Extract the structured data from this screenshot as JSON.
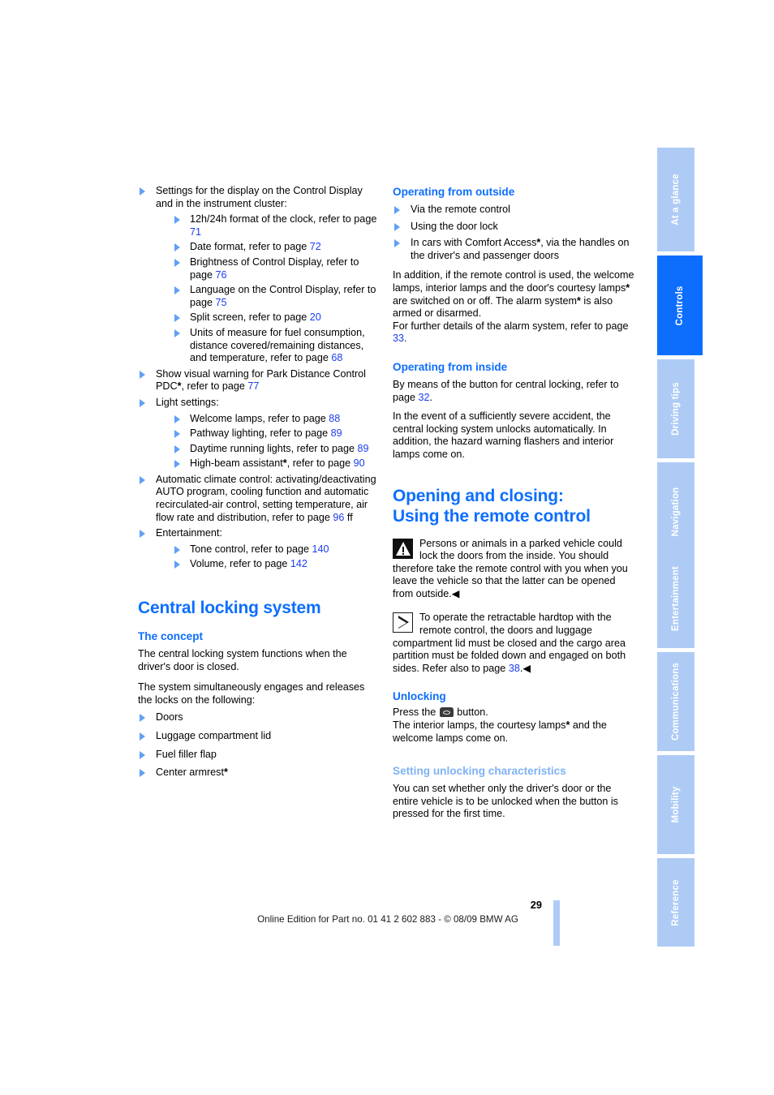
{
  "page": {
    "number": "29",
    "footer": "Online Edition for Part no. 01 41 2 602 883 - © 08/09 BMW AG"
  },
  "colors": {
    "accent_blue": "#0d6efd",
    "light_blue": "#aecbf5",
    "subheading_light": "#7fb2f5",
    "page_ref_blue": "#1a3df0",
    "bullet_blue": "#5fa0f7"
  },
  "sidebar": {
    "items": [
      {
        "label": "At a glance",
        "active": false
      },
      {
        "label": "Controls",
        "active": true
      },
      {
        "label": "Driving tips",
        "active": false
      },
      {
        "label": "Navigation",
        "active": false
      },
      {
        "label": "Entertainment",
        "active": false
      },
      {
        "label": "Communications",
        "active": false
      },
      {
        "label": "Mobility",
        "active": false
      },
      {
        "label": "Reference",
        "active": false
      }
    ]
  },
  "left_column": {
    "list": {
      "item1": {
        "text": "Settings for the display on the Control Display and in the instrument cluster:",
        "sub": [
          {
            "pre": "12h/24h format of the clock, refer to page ",
            "page": "71",
            "post": ""
          },
          {
            "pre": "Date format, refer to page ",
            "page": "72",
            "post": ""
          },
          {
            "pre": "Brightness of Control Display, refer to page ",
            "page": "76",
            "post": ""
          },
          {
            "pre": "Language on the Control Display, refer to page ",
            "page": "75",
            "post": ""
          },
          {
            "pre": "Split screen, refer to page ",
            "page": "20",
            "post": ""
          },
          {
            "pre": "Units of measure for fuel consumption, distance covered/remaining distances, and temperature, refer to page ",
            "page": "68",
            "post": ""
          }
        ]
      },
      "item2": {
        "pre": "Show visual warning for Park Distance Control PDC",
        "asterisk": "*",
        "mid": ", refer to page ",
        "page": "77",
        "post": ""
      },
      "item3": {
        "text": "Light settings:",
        "sub": [
          {
            "pre": "Welcome lamps, refer to page ",
            "page": "88",
            "post": ""
          },
          {
            "pre": "Pathway lighting, refer to page ",
            "page": "89",
            "post": ""
          },
          {
            "pre": "Daytime running lights, refer to page ",
            "page": "89",
            "post": ""
          },
          {
            "pre": "High-beam assistant",
            "asterisk": "*",
            "mid": ", refer to page ",
            "page": "90",
            "post": ""
          }
        ]
      },
      "item4": {
        "pre": "Automatic climate control: activating/deactivating AUTO program, cooling function and automatic recirculated-air control, setting temperature, air flow rate and distribution, refer to page ",
        "page": "96",
        "post": " ff"
      },
      "item5": {
        "text": "Entertainment:",
        "sub": [
          {
            "pre": "Tone control, refer to page ",
            "page": "140",
            "post": ""
          },
          {
            "pre": "Volume, refer to page ",
            "page": "142",
            "post": ""
          }
        ]
      }
    },
    "chapter_heading": "Central locking system",
    "concept": {
      "heading": "The concept",
      "para1": "The central locking system functions when the driver's door is closed.",
      "para2": "The system simultaneously engages and releases the locks on the following:",
      "items": [
        {
          "text": "Doors",
          "asterisk": ""
        },
        {
          "text": "Luggage compartment lid",
          "asterisk": ""
        },
        {
          "text": "Fuel filler flap",
          "asterisk": ""
        },
        {
          "text": "Center armrest",
          "asterisk": "*"
        }
      ]
    }
  },
  "right_column": {
    "outside": {
      "heading": "Operating from outside",
      "items": [
        {
          "pre": "Via the remote control",
          "asterisk": "",
          "post": ""
        },
        {
          "pre": "Using the door lock",
          "asterisk": "",
          "post": ""
        },
        {
          "pre": "In cars with Comfort Access",
          "asterisk": "*",
          "post": ", via the handles on the driver's and passenger doors"
        }
      ],
      "para_a": "In addition, if the remote control is used, the welcome lamps, interior lamps and the door's courtesy lamps",
      "para_a_ast": "*",
      "para_b": " are switched on or off. The alarm system",
      "para_b_ast": "*",
      "para_c": " is also armed or disarmed.",
      "para_d": "For further details of the alarm system, refer to page ",
      "para_d_page": "33",
      "para_d_post": "."
    },
    "inside": {
      "heading": "Operating from inside",
      "para1_pre": "By means of the button for central locking, refer to page ",
      "para1_page": "32",
      "para1_post": ".",
      "para2": "In the event of a sufficiently severe accident, the central locking system unlocks automatically. In addition, the hazard warning flashers and interior lamps come on."
    },
    "section_heading_line1": "Opening and closing:",
    "section_heading_line2": "Using the remote control",
    "warning_notice": {
      "icon": "warning-triangle-icon",
      "text": "Persons or animals in a parked vehicle could lock the doors from the inside. You should therefore take the remote control with you when you leave the vehicle so that the latter can be opened from outside.",
      "endmark": "◀"
    },
    "note_notice": {
      "icon": "note-triangle-icon",
      "text_pre": "To operate the retractable hardtop with the remote control, the doors and luggage compartment lid must be closed and the cargo area partition must be folded down and engaged on both sides. Refer also to page ",
      "page": "38",
      "text_post": ".",
      "endmark": "◀"
    },
    "unlocking": {
      "heading": "Unlocking",
      "line1_pre": "Press the ",
      "button_icon": "remote-unlock-button-icon",
      "line1_post": " button.",
      "line2_pre": "The interior lamps, the courtesy lamps",
      "line2_ast": "*",
      "line2_post": " and the welcome lamps come on."
    },
    "unlock_settings": {
      "heading": "Setting unlocking characteristics",
      "para": "You can set whether only the driver's door or the entire vehicle is to be unlocked when the button is pressed for the first time."
    }
  }
}
